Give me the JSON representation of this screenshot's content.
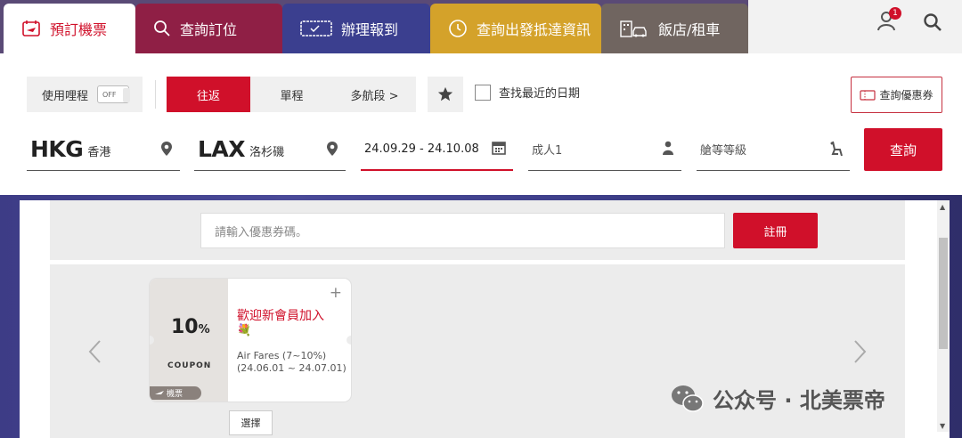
{
  "tabs": [
    {
      "label": "預訂機票",
      "icon": "plane-ticket-icon"
    },
    {
      "label": "查詢訂位",
      "icon": "search-icon"
    },
    {
      "label": "辦理報到",
      "icon": "boarding-pass-icon"
    },
    {
      "label": "查詢出發抵達資訊",
      "icon": "clock-icon"
    },
    {
      "label": "飯店/租車",
      "icon": "hotel-car-icon"
    }
  ],
  "header": {
    "notification_count": "1"
  },
  "search": {
    "miles_label": "使用哩程",
    "miles_toggle": "OFF",
    "trip_types": [
      "往返",
      "單程",
      "多航段 >"
    ],
    "recent_dates_label": "查找最近的日期",
    "coupon_button": "查詢優惠券",
    "from_code": "HKG",
    "from_city": "香港",
    "to_code": "LAX",
    "to_city": "洛杉磯",
    "dates": "24.09.29 - 24.10.08",
    "passengers": "成人1",
    "cabin_placeholder": "艙等等級",
    "submit": "查詢"
  },
  "coupon_dialog": {
    "input_placeholder": "請輸入優惠券碼。",
    "register_button": "註冊",
    "card": {
      "percent": "10",
      "percent_unit": "%",
      "coupon_word": "COUPON",
      "tag": "機票",
      "title": "歡迎新會員加入",
      "emoji": "💐",
      "desc_line1": "Air Fares (7~10%)",
      "desc_line2": "(24.06.01 ~ 24.07.01)"
    },
    "select_button": "選擇"
  },
  "watermark": "公众号 · 北美票帝",
  "colors": {
    "brand_red": "#d0102a"
  }
}
